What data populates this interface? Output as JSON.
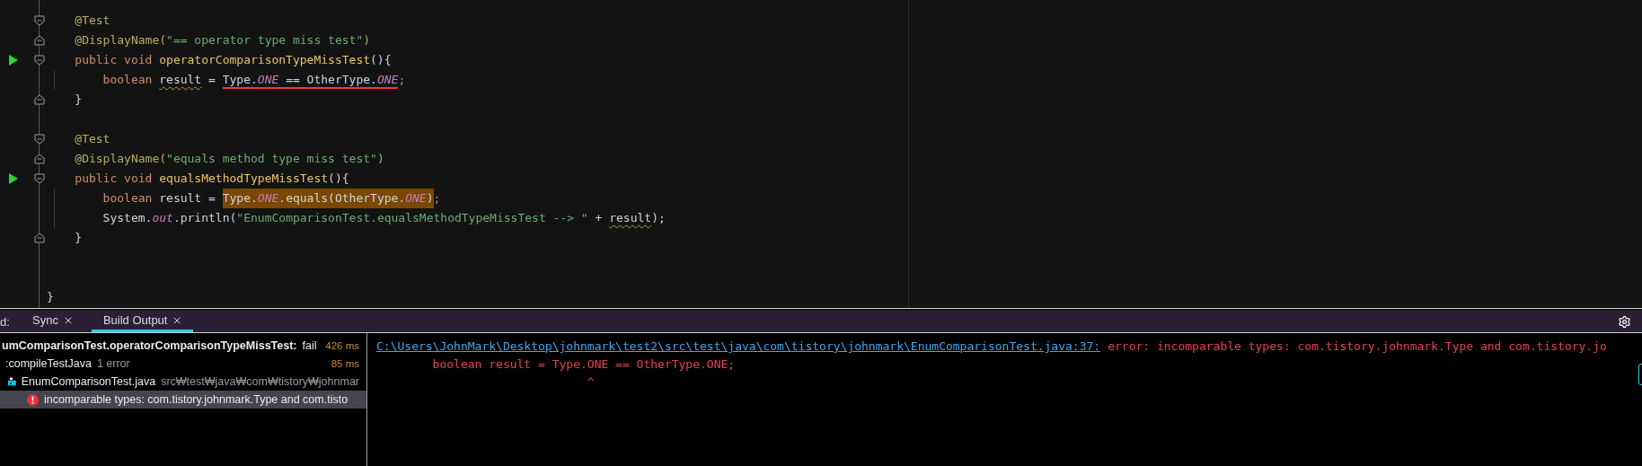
{
  "editor": {
    "lines": [
      {
        "run": false,
        "fold_start": true,
        "fold_end": false,
        "guide": false,
        "tokens": [
          {
            "text": "    @Test",
            "kind": "annotation"
          }
        ]
      },
      {
        "run": false,
        "fold_start": false,
        "fold_end": true,
        "guide": false,
        "tokens": [
          {
            "text": "    @DisplayName(",
            "kind": "annotation"
          },
          {
            "text": "\"== operator type miss test\"",
            "kind": "string"
          },
          {
            "text": ")",
            "kind": "annotation"
          }
        ]
      },
      {
        "run": true,
        "fold_start": true,
        "fold_end": false,
        "guide": false,
        "tokens": [
          {
            "text": "    public void ",
            "kind": "keyword"
          },
          {
            "text": "operatorComparisonTypeMissTest",
            "kind": "method"
          },
          {
            "text": "(){",
            "kind": "plain"
          }
        ]
      },
      {
        "run": false,
        "fold_start": false,
        "fold_end": false,
        "guide": true,
        "tokens": [
          {
            "text": "        boolean ",
            "kind": "keyword"
          },
          {
            "text": "result",
            "kind": "plain",
            "warning": true
          },
          {
            "text": " = ",
            "kind": "plain"
          },
          {
            "kind": "error",
            "tokens": [
              {
                "text": "Type.",
                "kind": "plain"
              },
              {
                "text": "ONE",
                "kind": "field"
              },
              {
                "text": " == OtherType.",
                "kind": "plain"
              },
              {
                "text": "ONE",
                "kind": "field"
              }
            ]
          },
          {
            "text": ";",
            "kind": "keyword"
          }
        ]
      },
      {
        "run": false,
        "fold_start": false,
        "fold_end": true,
        "guide": false,
        "tokens": [
          {
            "text": "    }",
            "kind": "plain"
          }
        ]
      },
      {
        "run": false,
        "fold_start": false,
        "fold_end": false,
        "guide": false
      },
      {
        "run": false,
        "fold_start": true,
        "fold_end": false,
        "guide": false,
        "tokens": [
          {
            "text": "    @Test",
            "kind": "annotation"
          }
        ]
      },
      {
        "run": false,
        "fold_start": false,
        "fold_end": true,
        "guide": false,
        "tokens": [
          {
            "text": "    @DisplayName(",
            "kind": "annotation"
          },
          {
            "text": "\"equals method type miss test\"",
            "kind": "string"
          },
          {
            "text": ")",
            "kind": "annotation"
          }
        ]
      },
      {
        "run": true,
        "fold_start": true,
        "fold_end": false,
        "guide": false,
        "tokens": [
          {
            "text": "    public void ",
            "kind": "keyword"
          },
          {
            "text": "equalsMethodTypeMissTest",
            "kind": "method"
          },
          {
            "text": "(){",
            "kind": "plain"
          }
        ]
      },
      {
        "run": false,
        "fold_start": false,
        "fold_end": false,
        "guide": true,
        "tokens": [
          {
            "text": "        boolean ",
            "kind": "keyword"
          },
          {
            "text": "result = ",
            "kind": "plain"
          },
          {
            "kind": "highlight",
            "tokens": [
              {
                "text": "Type.",
                "kind": "plain"
              },
              {
                "text": "ONE",
                "kind": "field"
              },
              {
                "text": ".equals(OtherType.",
                "kind": "plain"
              },
              {
                "text": "ONE",
                "kind": "field"
              },
              {
                "text": ")",
                "kind": "plain"
              }
            ]
          },
          {
            "text": ";",
            "kind": "keyword"
          }
        ]
      },
      {
        "run": false,
        "fold_start": false,
        "fold_end": false,
        "guide": true,
        "tokens": [
          {
            "text": "        System.",
            "kind": "plain"
          },
          {
            "text": "out",
            "kind": "field"
          },
          {
            "text": ".println(",
            "kind": "plain"
          },
          {
            "text": "\"EnumComparisonTest.equalsMethodTypeMissTest --> \"",
            "kind": "string"
          },
          {
            "text": " + ",
            "kind": "plain"
          },
          {
            "text": "result",
            "kind": "plain",
            "warning": true
          },
          {
            "text": ");",
            "kind": "plain"
          }
        ]
      },
      {
        "run": false,
        "fold_start": false,
        "fold_end": true,
        "guide": false,
        "tokens": [
          {
            "text": "    }",
            "kind": "plain"
          }
        ]
      },
      {
        "run": false,
        "fold_start": false,
        "fold_end": false,
        "guide": false
      },
      {
        "run": false,
        "fold_start": false,
        "fold_end": false,
        "guide": false
      },
      {
        "run": false,
        "fold_start": false,
        "fold_end": false,
        "guide": false,
        "tokens": [
          {
            "text": "}",
            "kind": "plain"
          }
        ]
      }
    ]
  },
  "tool_window": {
    "label": "d:",
    "tabs": [
      {
        "label": "Sync",
        "selected": false
      },
      {
        "label": "Build Output",
        "selected": true
      }
    ],
    "tree": [
      {
        "kind": "test",
        "label": "umComparisonTest.operatorComparisonTypeMissTest:",
        "status": "fail",
        "time": "426 ms",
        "selected": false,
        "children": [
          {
            "label": ":compileTestJava",
            "detail": "1 error",
            "time": "85 ms",
            "selected": false,
            "children": [
              {
                "kind": "file",
                "label": "EnumComparisonTest.java",
                "detail": "src₩test₩java₩com₩tistory₩johnmar",
                "selected": false,
                "children": [
                  {
                    "kind": "error",
                    "label": "incomparable types: com.tistory.johnmark.Type and com.tisto",
                    "selected": true
                  }
                ]
              }
            ]
          }
        ]
      }
    ]
  },
  "output": {
    "link": "C:\\Users\\JohnMark\\Desktop\\johnmark\\test2\\src\\test\\java\\com\\tistory\\johnmark\\EnumComparisonTest.java:37:",
    "message": "error: incomparable types: com.tistory.johnmark.Type and com.tistory.jo",
    "lines": [
      "        boolean result = Type.ONE == OtherType.ONE;",
      "                              ^"
    ]
  }
}
